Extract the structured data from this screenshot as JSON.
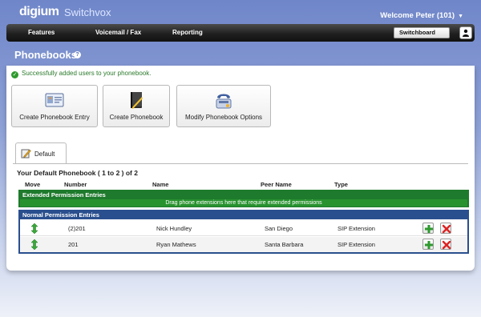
{
  "brand": {
    "logo_text": "digium",
    "product": "Switchvox"
  },
  "header": {
    "welcome": "Welcome Peter (101)",
    "switchboard_label": "Switchboard"
  },
  "nav": {
    "items": [
      "Features",
      "Voicemail / Fax",
      "Reporting"
    ]
  },
  "page": {
    "title": "Phonebooks",
    "help": "?"
  },
  "notice": {
    "success": "Successfully added users to your phonebook."
  },
  "actions": [
    {
      "label": "Create Phonebook Entry",
      "icon": "id-card-icon"
    },
    {
      "label": "Create Phonebook",
      "icon": "book-icon"
    },
    {
      "label": "Modify Phonebook Options",
      "icon": "phone-options-icon"
    }
  ],
  "tabs": [
    {
      "label": "Default"
    }
  ],
  "phonebook": {
    "title": "Your Default Phonebook  ( 1 to 2 ) of 2",
    "columns": {
      "move": "Move",
      "number": "Number",
      "name": "Name",
      "peer_name": "Peer Name",
      "type": "Type"
    },
    "extended": {
      "header": "Extended Permission Entries",
      "message": "Drag phone extensions here that require extended permissions"
    },
    "normal": {
      "header": "Normal Permission Entries",
      "rows": [
        {
          "number": "(2)201",
          "name": "Nick Hundley",
          "peer_name": "San Diego",
          "type": "SIP Extension"
        },
        {
          "number": "201",
          "name": "Ryan Mathews",
          "peer_name": "Santa Barbara",
          "type": "SIP Extension"
        }
      ]
    }
  },
  "colors": {
    "nav_bg": "#1a1a1a",
    "extended_green": "#1e7a2c",
    "normal_blue": "#2a4f8e",
    "success_green": "#2a7a2a"
  }
}
